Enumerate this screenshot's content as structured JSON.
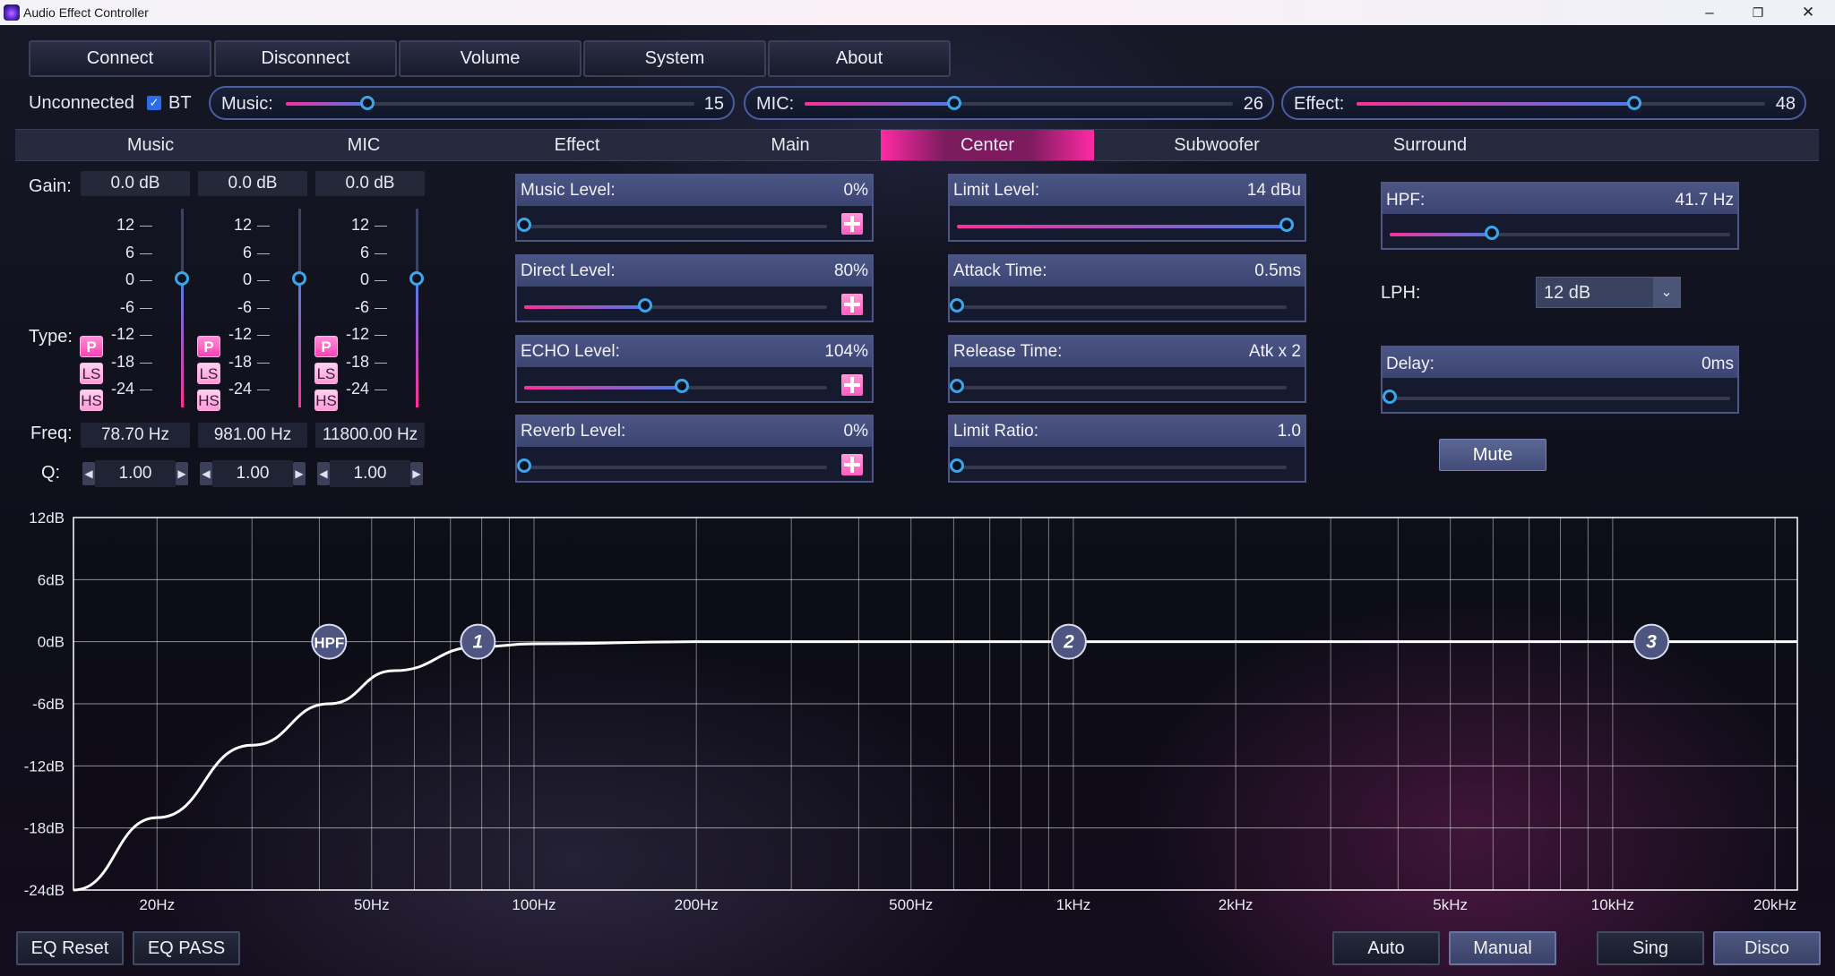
{
  "window": {
    "title": "Audio Effect Controller",
    "min_icon": "minimize-icon",
    "max_icon": "restore-icon",
    "close_icon": "close-icon"
  },
  "toolbar": {
    "buttons": [
      "Connect",
      "Disconnect",
      "Volume",
      "System",
      "About"
    ]
  },
  "status": {
    "connection": "Unconnected",
    "bt_label": "BT",
    "bt_checked": true
  },
  "volumes": [
    {
      "label": "Music:",
      "value": "15",
      "level": 0.2
    },
    {
      "label": "MIC:",
      "value": "26",
      "level": 0.35
    },
    {
      "label": "Effect:",
      "value": "48",
      "level": 0.68
    }
  ],
  "tabs": [
    "Music",
    "MIC",
    "Effect",
    "Main",
    "Center",
    "Subwoofer",
    "Surround"
  ],
  "active_tab": "Center",
  "eq_bands": {
    "gain_label": "Gain:",
    "type_label": "Type:",
    "freq_label": "Freq:",
    "q_label": "Q:",
    "scale": [
      "12",
      "6",
      "0",
      "-6",
      "-12",
      "-18",
      "-24"
    ],
    "type_buttons": [
      "P",
      "LS",
      "HS"
    ],
    "bands": [
      {
        "gain": "0.0 dB",
        "freq": "78.70 Hz",
        "q": "1.00",
        "type": "P"
      },
      {
        "gain": "0.0 dB",
        "freq": "981.00 Hz",
        "q": "1.00",
        "type": "P"
      },
      {
        "gain": "0.0 dB",
        "freq": "11800.00 Hz",
        "q": "1.00",
        "type": "P"
      }
    ]
  },
  "effect_levels": [
    {
      "label": "Music Level:",
      "value": "0%",
      "level": 0.0
    },
    {
      "label": "Direct Level:",
      "value": "80%",
      "level": 0.4
    },
    {
      "label": "ECHO Level:",
      "value": "104%",
      "level": 0.52
    },
    {
      "label": "Reverb Level:",
      "value": "0%",
      "level": 0.0
    }
  ],
  "limiter": [
    {
      "label": "Limit Level:",
      "value": "14 dBu",
      "level": 1.0
    },
    {
      "label": "Attack Time:",
      "value": "0.5ms",
      "level": 0.0
    },
    {
      "label": "Release Time:",
      "value": "Atk x  2",
      "level": 0.0
    },
    {
      "label": "Limit Ratio:",
      "value": "1.0",
      "level": 0.0
    }
  ],
  "filters": {
    "hpf_label": "HPF:",
    "hpf_value": "41.7 Hz",
    "hpf_level": 0.3,
    "lph_label": "LPH:",
    "lph_value": "12 dB",
    "delay_label": "Delay:",
    "delay_value": "0ms",
    "delay_level": 0.0,
    "mute_label": "Mute"
  },
  "chart_data": {
    "type": "line",
    "title": "",
    "xlabel": "",
    "ylabel": "",
    "x_scale": "log",
    "xlim": [
      14,
      22000
    ],
    "ylim": [
      -24,
      12
    ],
    "y_ticks": [
      "12dB",
      "6dB",
      "0dB",
      "-6dB",
      "-12dB",
      "-18dB",
      "-24dB"
    ],
    "x_ticks": [
      "20Hz",
      "50Hz",
      "100Hz",
      "200Hz",
      "500Hz",
      "1kHz",
      "2kHz",
      "5kHz",
      "10kHz",
      "20kHz"
    ],
    "grid": true,
    "series": [
      {
        "x": [
          14,
          20,
          30,
          41.7,
          55,
          78.7,
          100,
          200,
          1000,
          10000,
          22000
        ],
        "y": [
          -24,
          -17,
          -10,
          -6,
          -2.8,
          -0.5,
          -0.2,
          0,
          0,
          0,
          0
        ]
      }
    ],
    "markers": [
      {
        "label": "HPF",
        "x": 41.7,
        "y": 0
      },
      {
        "label": "1",
        "x": 78.7,
        "y": 0
      },
      {
        "label": "2",
        "x": 981,
        "y": 0
      },
      {
        "label": "3",
        "x": 11800,
        "y": 0
      }
    ]
  },
  "bottom": {
    "eq_reset": "EQ Reset",
    "eq_pass": "EQ PASS",
    "auto": "Auto",
    "manual": "Manual",
    "sing": "Sing",
    "disco": "Disco"
  }
}
